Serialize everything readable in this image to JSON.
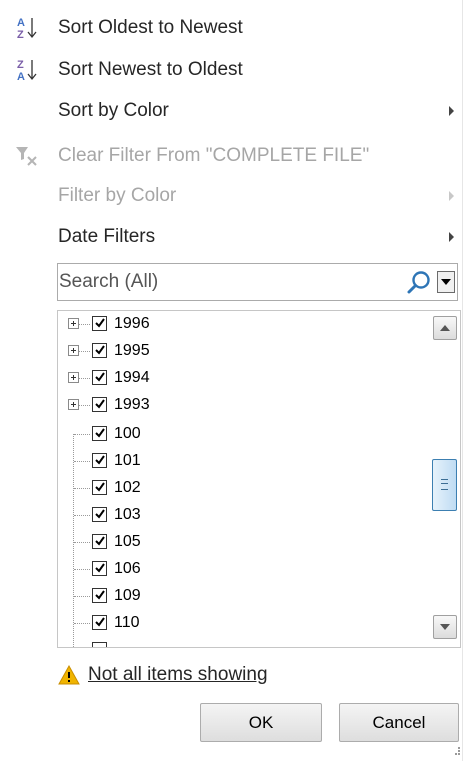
{
  "menu": {
    "sort_oldest": "Sort Oldest to Newest",
    "sort_newest": "Sort Newest to Oldest",
    "sort_color": "Sort by Color",
    "clear_filter": "Clear Filter From \"COMPLETE FILE\"",
    "filter_color": "Filter by Color",
    "date_filters": "Date Filters"
  },
  "search": {
    "placeholder": "Search (All)"
  },
  "tree": {
    "years": [
      "1996",
      "1995",
      "1994",
      "1993"
    ],
    "items": [
      "100",
      "101",
      "102",
      "103",
      "105",
      "106",
      "109",
      "110"
    ]
  },
  "warning": {
    "text": "Not all items showing"
  },
  "buttons": {
    "ok": "OK",
    "cancel": "Cancel"
  },
  "colors": {
    "accent": "#4472c4",
    "warning": "#f0b400",
    "disabled": "#a6a6a6"
  }
}
